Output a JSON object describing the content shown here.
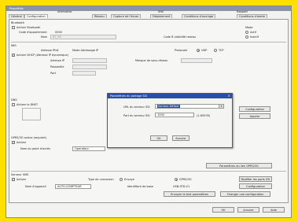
{
  "window": {
    "title": "Propriétés"
  },
  "tabs": [
    "Général",
    "Configuration",
    "Réseau",
    "Capture de l'écran",
    "Déploiement",
    "Conditions d'ouvrage",
    "Conditions d'alerte"
  ],
  "tab_groups": [
    "Intervalles",
    "SNS",
    "Rapport"
  ],
  "network": {
    "group_label": "Bluetooth",
    "bt_check": "Activer Bluetooth",
    "bt_name_label": "Code d'appariement",
    "bt_name_value": "0000",
    "addr_label": "Nom",
    "addr_value": "BT_96",
    "addr_hint": "Code B visibilité reseau",
    "mode_label": "Mode",
    "mode_opt1": "Actif",
    "mode_opt2": "Inactif",
    "wifi_label": "Wifi",
    "ip_label": "Adresse IPv6",
    "ip_value": "Mode Adressage IP",
    "protocol_label": "Protocole",
    "proto1": "UDP",
    "proto2": "TCP",
    "dhcp_check": "Activer DHCP (Adresse IP dynamique)",
    "addr_ip_label": "Adresse IP",
    "mask_label": "Masque de sous-réseau",
    "gateway_label": "Passerelle",
    "port_label": "Port",
    "dns_check": "Activer le DNS?",
    "dns_btn1": "Configuration",
    "dns_btn2": "Ajouter",
    "wps_label": "GPRS/3G active (requiert)",
    "wps_check": "Activer",
    "apn_label": "Nom du point d'accès",
    "apn_value": "Operateur",
    "param_btn": "Paramètres du lien GPRS/3G",
    "sms_label": "Serveur SMS",
    "sms_check": "Activer",
    "conn_label": "Type de connexion",
    "conn_opt1": "Envoye",
    "conn_opt2": "GPRS/3G",
    "hour_label": "Nom d'appareil",
    "hour_value": "AUTH-COMPTEUR",
    "id_label": "Identifiant de base",
    "id_value": "USB-STD-V1",
    "btn_redirect": "Modifier les ports SSI",
    "btn_config": "Configuration",
    "btn_test": "Envoyer le test paramètres",
    "btn_load": "Changer une configuration"
  },
  "dialog": {
    "title": "Paramètres du partage SSI",
    "url_label": "URL du serveur SSI",
    "url_value": "Serveur-Défaut",
    "port_label": "Port du serveur SSI",
    "port_value": "1000",
    "port_hint": "(1-65535)",
    "ok": "OK",
    "cancel": "Annuler"
  },
  "footer": {
    "ok": "OK",
    "cancel": "Annuler",
    "apply": "Aide"
  }
}
